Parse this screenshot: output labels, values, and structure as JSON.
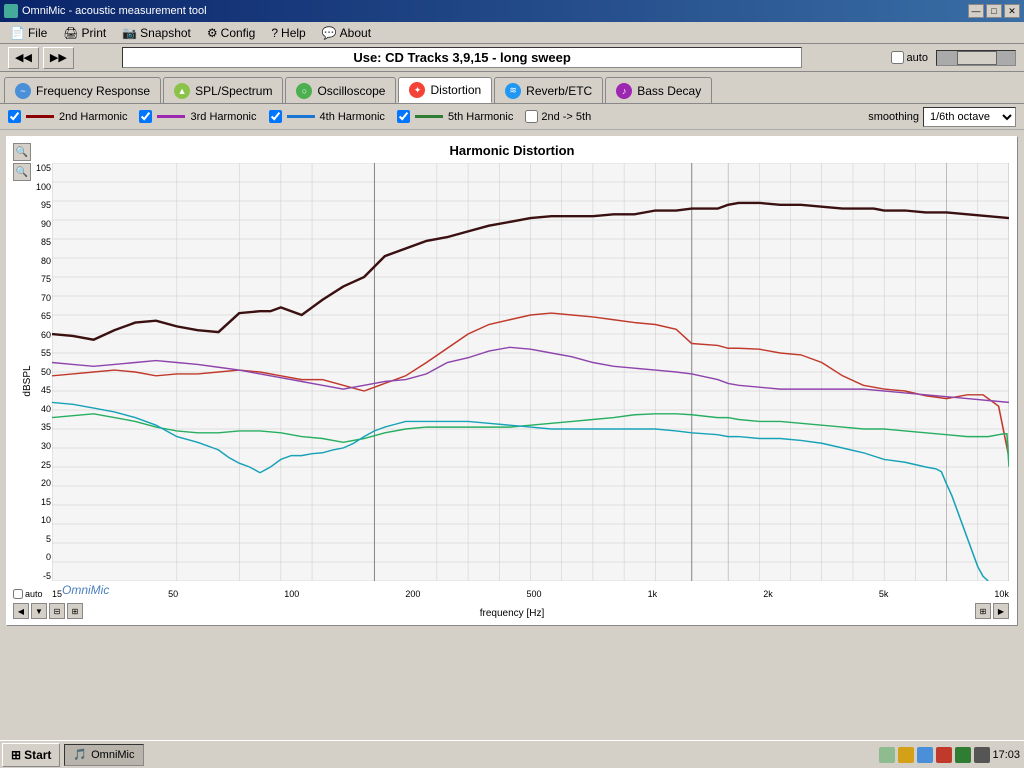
{
  "titleBar": {
    "title": "OmniMic - acoustic measurement tool",
    "minBtn": "—",
    "maxBtn": "□",
    "closeBtn": "✕"
  },
  "menu": {
    "items": [
      {
        "label": "File",
        "icon": "📄"
      },
      {
        "label": "Print",
        "icon": "🖨"
      },
      {
        "label": "Snapshot",
        "icon": "📷"
      },
      {
        "label": "Config",
        "icon": "⚙"
      },
      {
        "label": "Help",
        "icon": "?"
      },
      {
        "label": "About",
        "icon": "💬"
      }
    ]
  },
  "trackBar": {
    "label": "Use: CD Tracks 3,9,15 - long sweep",
    "autoLabel": "auto"
  },
  "tabs": [
    {
      "label": "Frequency Response",
      "iconColor": "#4a90d9",
      "active": false
    },
    {
      "label": "SPL/Spectrum",
      "iconColor": "#8bc34a",
      "active": false
    },
    {
      "label": "Oscilloscope",
      "iconColor": "#4caf50",
      "active": false
    },
    {
      "label": "Distortion",
      "iconColor": "#f44336",
      "active": true
    },
    {
      "label": "Reverb/ETC",
      "iconColor": "#2196f3",
      "active": false
    },
    {
      "label": "Bass Decay",
      "iconColor": "#9c27b0",
      "active": false
    }
  ],
  "harmonics": {
    "items": [
      {
        "label": "2nd Harmonic",
        "color": "#8b0000",
        "checked": true
      },
      {
        "label": "3rd Harmonic",
        "color": "#9c27b0",
        "checked": true
      },
      {
        "label": "4th Harmonic",
        "color": "#1976d2",
        "checked": true
      },
      {
        "label": "5th Harmonic",
        "color": "#2e7d32",
        "checked": true
      },
      {
        "label": "2nd -> 5th",
        "color": "#555555",
        "checked": false
      }
    ],
    "smoothingLabel": "smoothing",
    "smoothingValue": "1/6th octave"
  },
  "chart": {
    "title": "Harmonic Distortion",
    "yAxisLabel": "dBSPL",
    "xAxisLabel": "frequency [Hz]",
    "yTicks": [
      105,
      100,
      95,
      90,
      85,
      80,
      75,
      70,
      65,
      60,
      55,
      50,
      45,
      40,
      35,
      30,
      25,
      20,
      15,
      10,
      5,
      0,
      -5
    ],
    "xTicks": [
      "",
      "15",
      "50",
      "100",
      "200",
      "500",
      "1k",
      "2k",
      "5k",
      "10k"
    ],
    "xTickLabels": [
      "15",
      "50",
      "100",
      "200",
      "500",
      "1k",
      "2k",
      "5k",
      "10k",
      "10k"
    ]
  },
  "zoomControls": [
    "+",
    "-",
    "←↑",
    "↓→"
  ],
  "watermark": "OmniMic",
  "taskbar": {
    "startLabel": "Start",
    "appLabel": "OmniMic",
    "time": "17:03"
  }
}
